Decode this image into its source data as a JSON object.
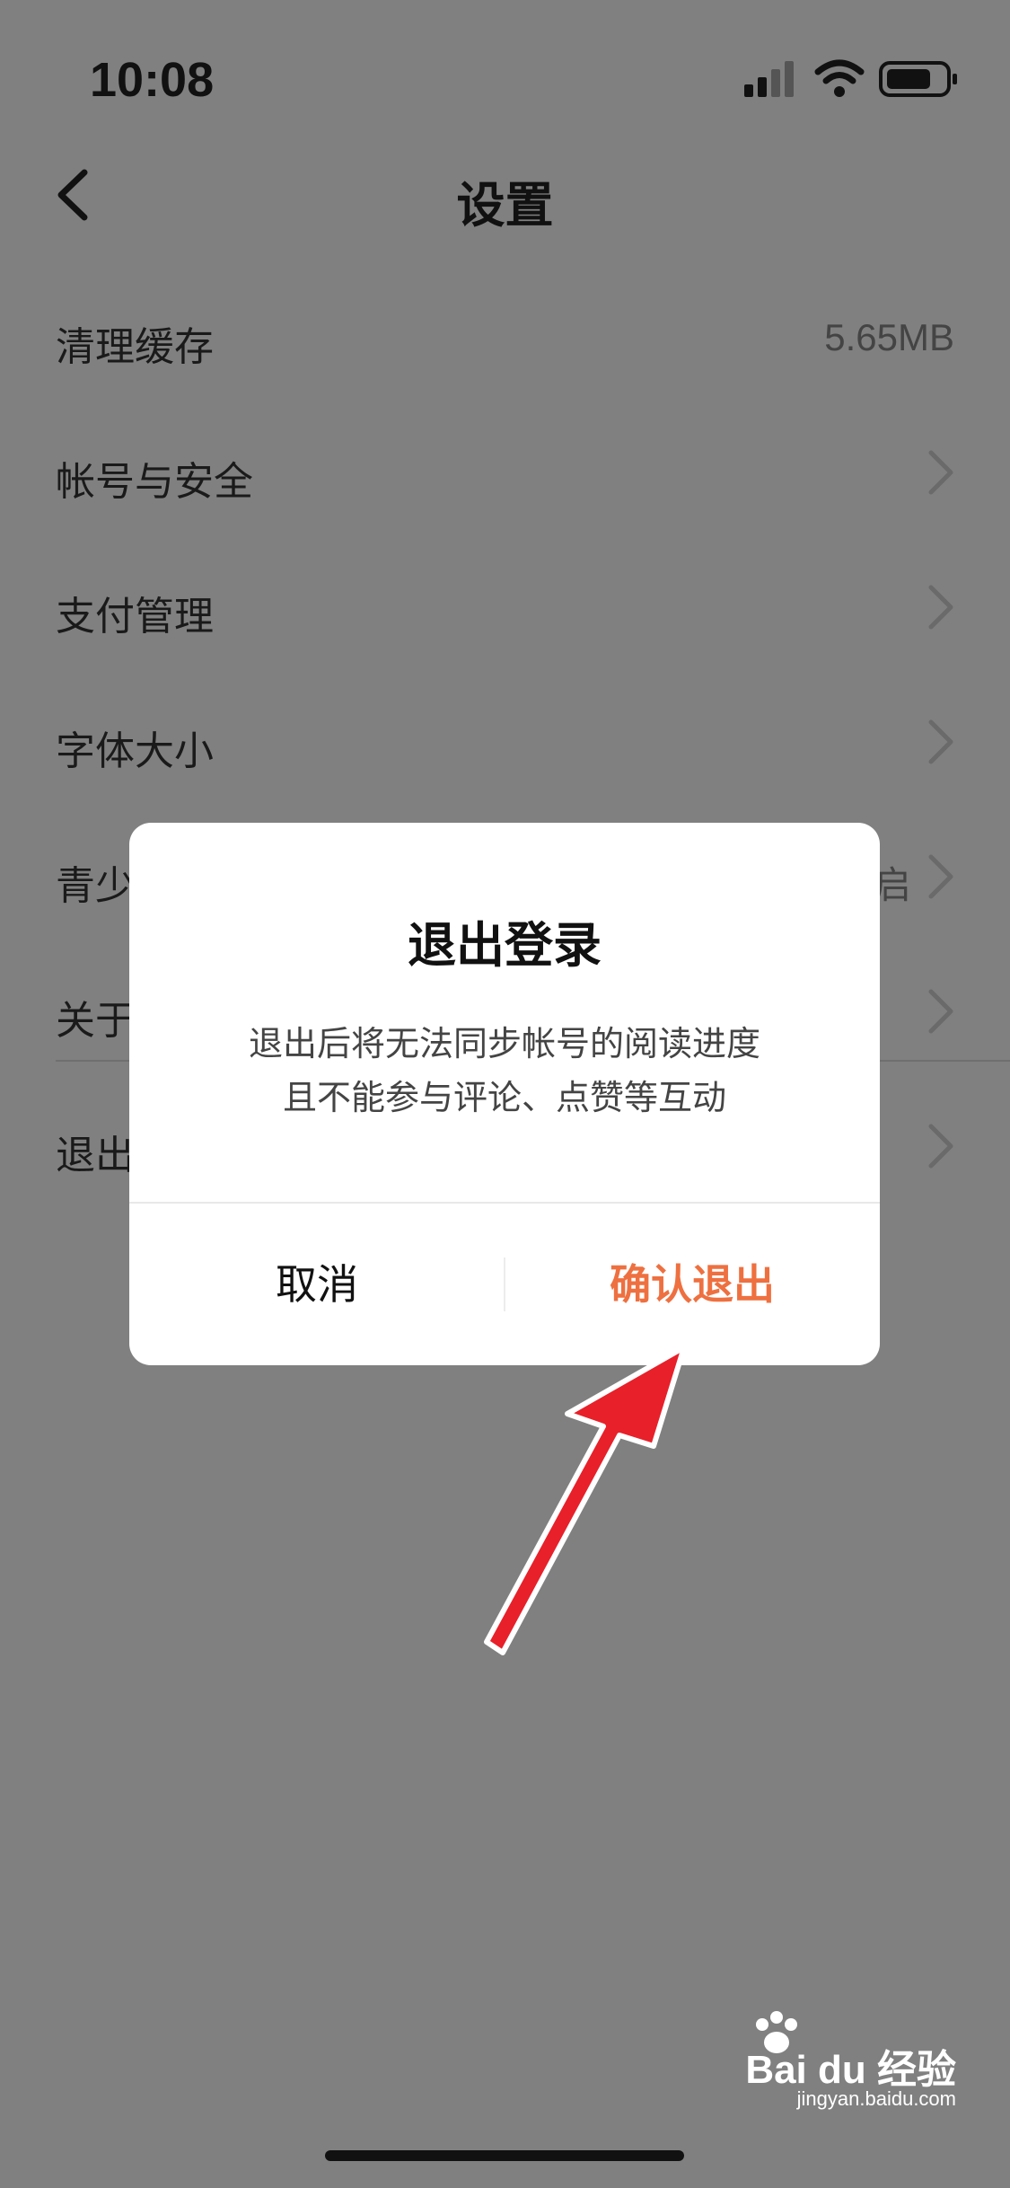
{
  "status_bar": {
    "time": "10:08"
  },
  "nav": {
    "title": "设置"
  },
  "settings": {
    "items": [
      {
        "label": "清理缓存",
        "value": "5.65MB"
      },
      {
        "label": "帐号与安全"
      },
      {
        "label": "支付管理"
      },
      {
        "label": "字体大小"
      },
      {
        "label": "青少",
        "right_text": "启"
      },
      {
        "label": "关于"
      },
      {
        "label": "退出"
      }
    ]
  },
  "dialog": {
    "title": "退出登录",
    "message_line1": "退出后将无法同步帐号的阅读进度",
    "message_line2": "且不能参与评论、点赞等互动",
    "cancel_label": "取消",
    "confirm_label": "确认退出"
  },
  "watermark": {
    "brand": "Bai du 经验",
    "url": "jingyan.baidu.com"
  },
  "colors": {
    "accent": "#ee7040",
    "overlay": "#808080",
    "arrow": "#e8202a"
  },
  "icons": [
    "back-icon",
    "chevron-right-icon",
    "signal-icon",
    "wifi-icon",
    "battery-icon",
    "paw-icon"
  ]
}
